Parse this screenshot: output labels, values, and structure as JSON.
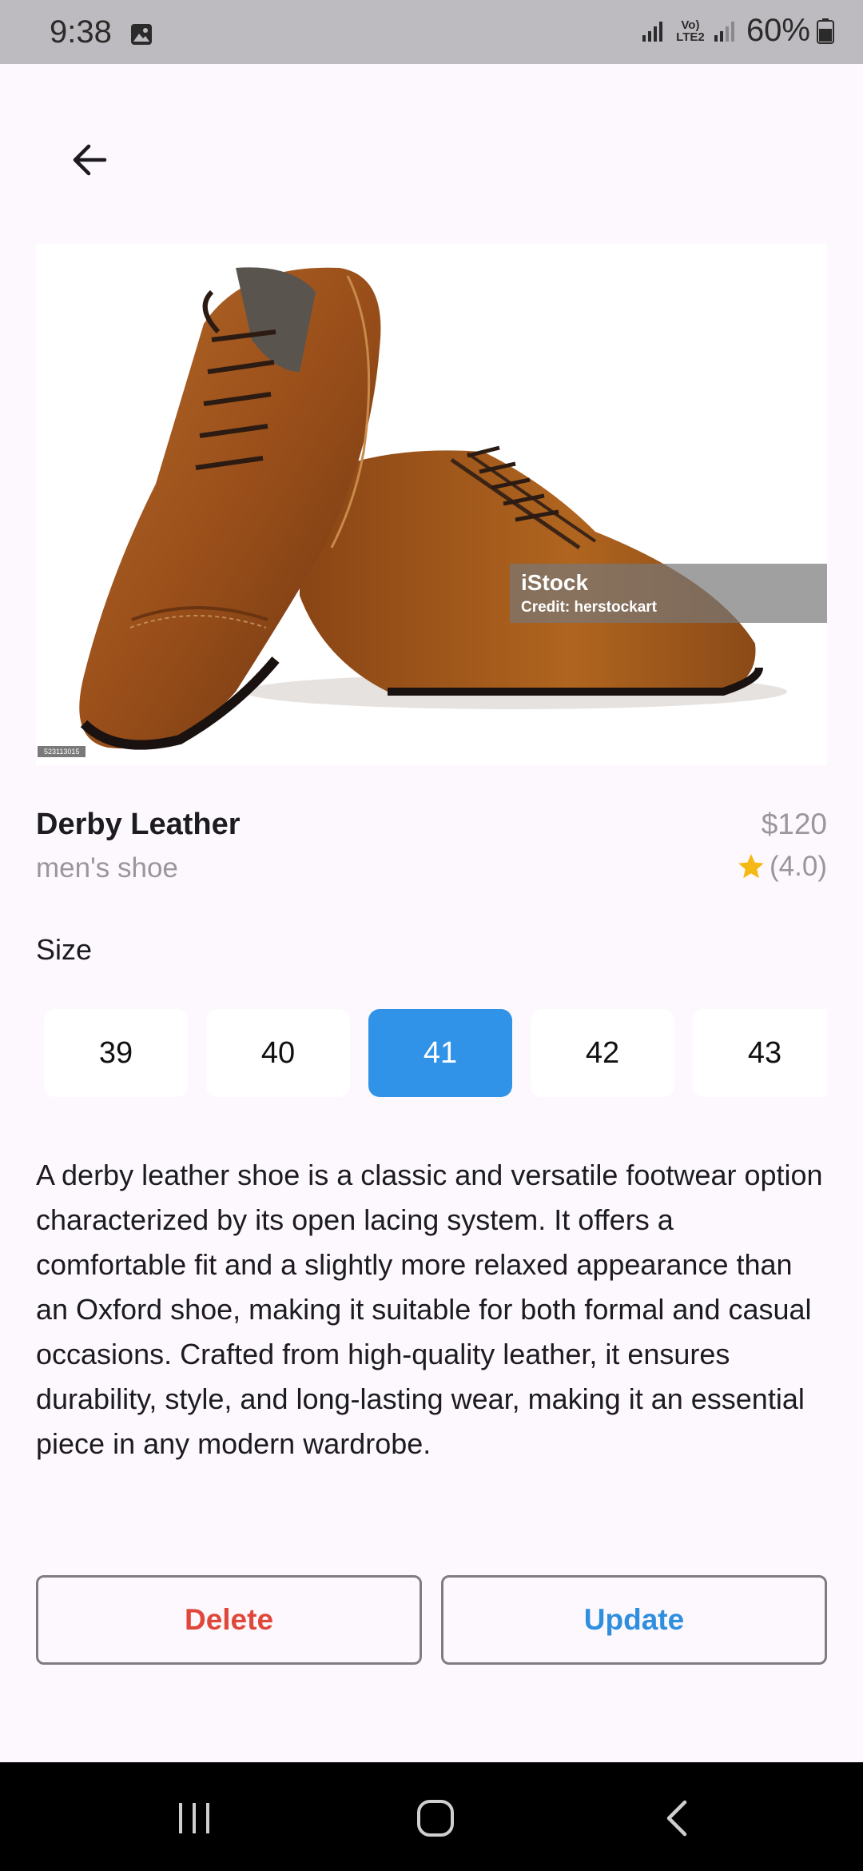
{
  "status_bar": {
    "time": "9:38",
    "network_label": "Vo) LTE2",
    "battery": "60%",
    "icons": [
      "image-icon",
      "signal-icon",
      "signal-icon",
      "battery-icon"
    ]
  },
  "nav": {
    "back_icon": "arrow-left-icon"
  },
  "image": {
    "subject": "brown leather derby shoes",
    "watermark_logo": "iStock",
    "watermark_credit": "Credit: herstockart",
    "stock_id": "523113015"
  },
  "product": {
    "name": "Derby Leather",
    "category": "men's shoe",
    "price": "$120",
    "rating_text": "(4.0)",
    "rating_value": 4.0,
    "star_color": "#f5b916"
  },
  "sizes": {
    "label": "Size",
    "options": [
      "39",
      "40",
      "41",
      "42",
      "43"
    ],
    "selected": "41",
    "selected_color": "#3193e8"
  },
  "description": "A derby leather shoe is a classic and versatile footwear option characterized by its open lacing system. It offers a comfortable fit and a slightly more relaxed appearance than an Oxford shoe, making it suitable for both formal and casual occasions. Crafted from high-quality leather, it ensures durability, style, and long-lasting wear, making it an essential piece in any modern wardrobe.",
  "actions": {
    "delete_label": "Delete",
    "update_label": "Update",
    "delete_color": "#e0473a",
    "update_color": "#2f8fdf"
  },
  "system_nav": {
    "icons": [
      "recents-icon",
      "home-icon",
      "back-icon"
    ]
  }
}
